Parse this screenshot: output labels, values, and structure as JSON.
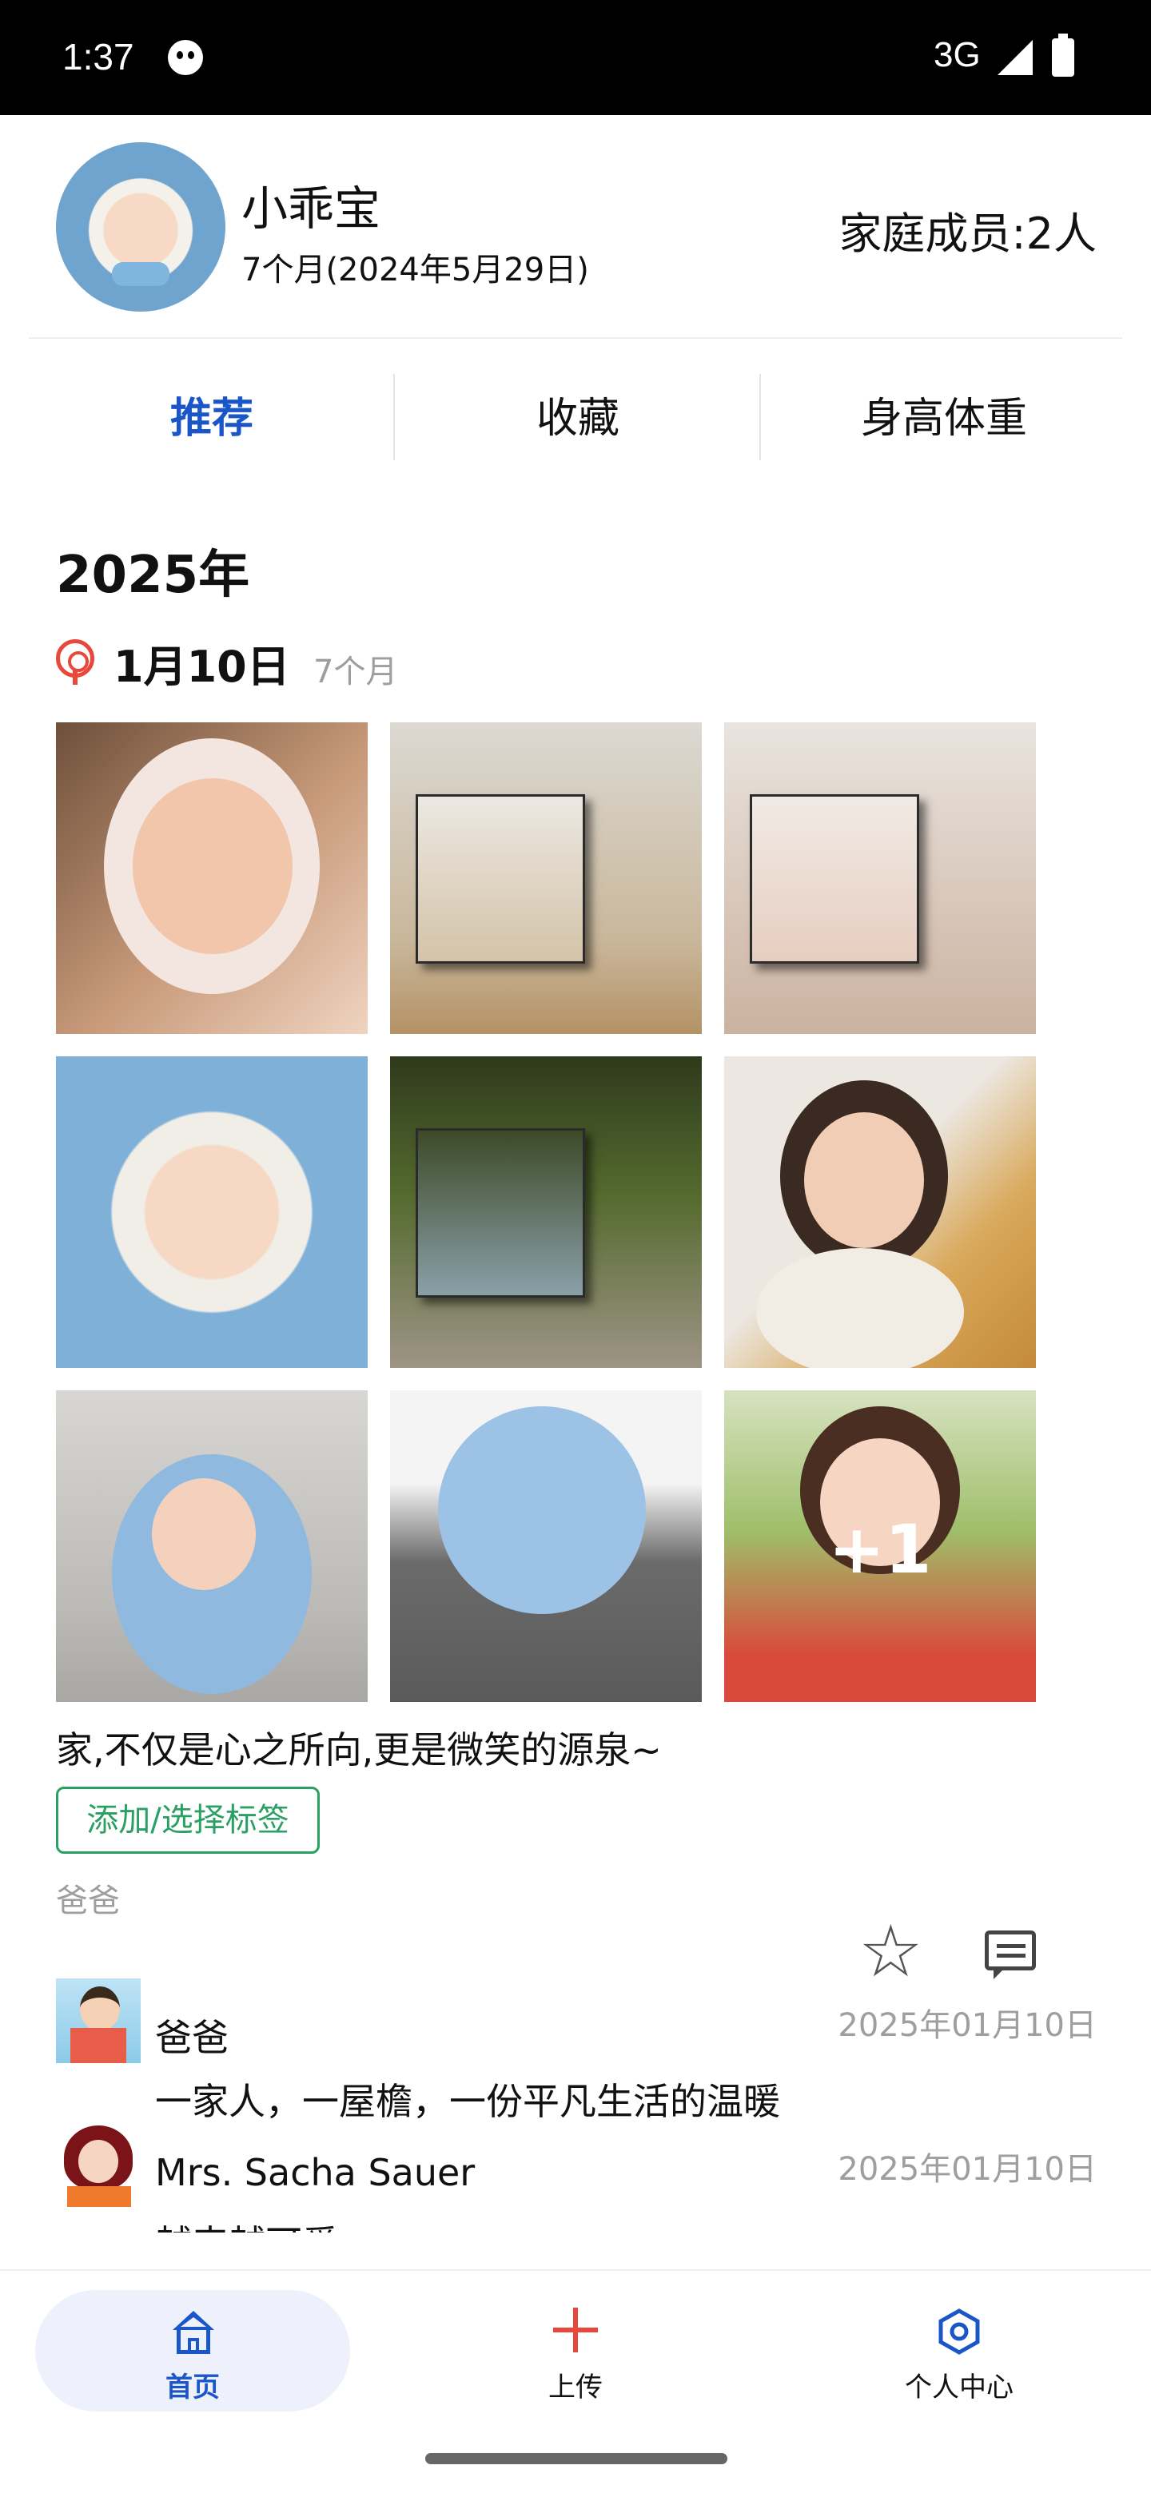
{
  "status_bar": {
    "time": "1:37",
    "network": "3G"
  },
  "profile": {
    "name": "小乖宝",
    "age": "7个月(2024年5月29日)",
    "family_members": "家庭成员:2人"
  },
  "tabs": [
    {
      "label": "推荐",
      "active": true
    },
    {
      "label": "收藏",
      "active": false
    },
    {
      "label": "身高体重",
      "active": false
    }
  ],
  "timeline": {
    "year": "2025年",
    "date": "1月10日",
    "age": "7个月",
    "extra_photos": "+1",
    "caption": "家,不仅是心之所向,更是微笑的源泉~",
    "tag_button": "添加/选择标签",
    "author": "爸爸"
  },
  "comments": [
    {
      "name": "爸爸",
      "date": "2025年01月10日",
      "text": "一家人，一屋檐，一份平凡生活的温暖"
    },
    {
      "name": "Mrs. Sacha Sauer",
      "date": "2025年01月10日",
      "text": "越来越可爱"
    }
  ],
  "bottom_nav": [
    {
      "label": "首页",
      "active": true
    },
    {
      "label": "上传",
      "active": false
    },
    {
      "label": "个人中心",
      "active": false
    }
  ],
  "colors": {
    "accent": "#1a56c8",
    "red": "#e8473c",
    "green": "#2aa064",
    "muted": "#9e9e9e"
  }
}
